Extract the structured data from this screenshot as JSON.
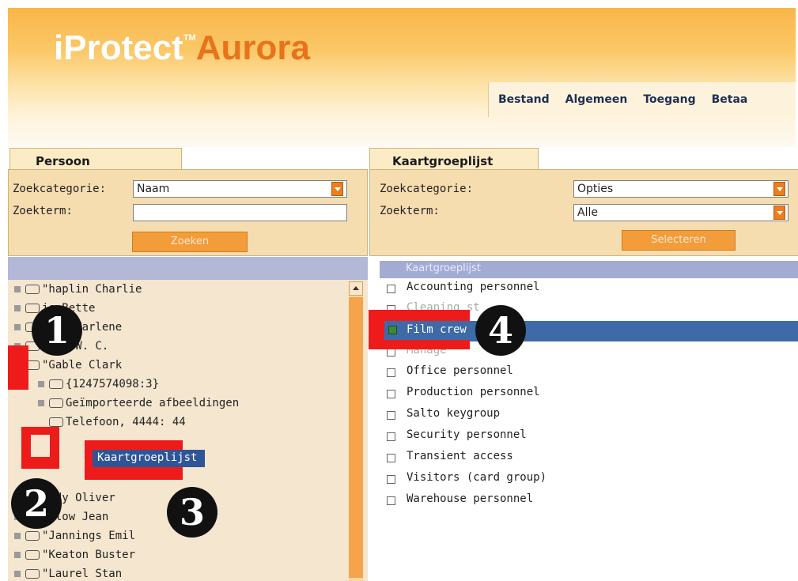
{
  "app": {
    "logo_main": "iProtect",
    "logo_tm": "TM",
    "logo_accent": "Aurora"
  },
  "menu": [
    "Bestand",
    "Algemeen",
    "Toegang",
    "Betaa"
  ],
  "left_panel": {
    "tab": "Persoon",
    "search_category_label": "Zoekcategorie:",
    "search_category_value": "Naam",
    "search_term_label": "Zoekterm:",
    "search_term_value": "",
    "search_button": "Zoeken"
  },
  "tree": [
    {
      "text": "\"haplin Charlie"
    },
    {
      "text": "is Bette"
    },
    {
      "text": "rich Marlene"
    },
    {
      "text": "elds W. C."
    },
    {
      "text": "\"Gable Clark"
    },
    {
      "text": "{1247574098:3}"
    },
    {
      "text": "Geïmporteerde afbeeldingen"
    },
    {
      "text": "Telefoon, 4444: 44"
    },
    {
      "text": "Kaartgroeplijst"
    },
    {
      "text": "ardy Oliver"
    },
    {
      "text": "arlow Jean"
    },
    {
      "text": "\"Jannings Emil"
    },
    {
      "text": "\"Keaton Buster"
    },
    {
      "text": "\"Laurel Stan"
    }
  ],
  "right_panel": {
    "tab": "Kaartgroeplijst",
    "search_category_label": "Zoekcategorie:",
    "search_category_value": "Opties",
    "search_term_label": "Zoekterm:",
    "search_term_value": "Alle",
    "select_button": "Selecteren",
    "list_header": "Kaartgroeplijst",
    "items": [
      {
        "label": "Accounting personnel",
        "checked": false
      },
      {
        "label": "Cleaning st",
        "checked": false
      },
      {
        "label": "Film crew",
        "checked": true
      },
      {
        "label": "Manage",
        "checked": false
      },
      {
        "label": "Office personnel",
        "checked": false
      },
      {
        "label": "Production personnel",
        "checked": false
      },
      {
        "label": "Salto keygroup",
        "checked": false
      },
      {
        "label": "Security personnel",
        "checked": false
      },
      {
        "label": "Transient access",
        "checked": false
      },
      {
        "label": "Visitors (card group)",
        "checked": false
      },
      {
        "label": "Warehouse personnel",
        "checked": false
      }
    ]
  },
  "annotations": [
    "1",
    "2",
    "3",
    "4"
  ],
  "colors": {
    "header_orange": "#f9b64a",
    "accent_orange": "#ec7e1b",
    "selection_blue": "#3e6aa8",
    "highlight_red": "#ee1b1b"
  }
}
